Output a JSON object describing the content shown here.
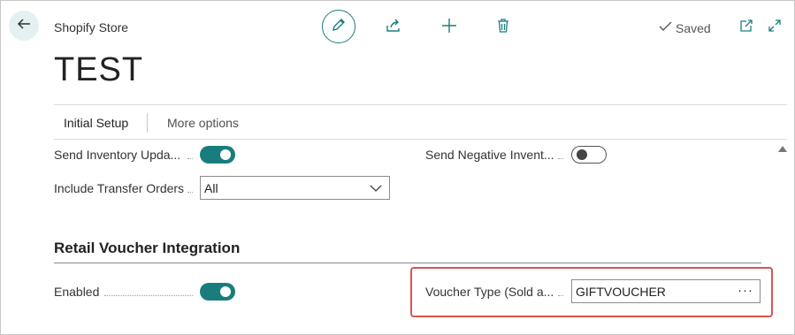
{
  "header": {
    "caption": "Shopify Store",
    "title": "TEST",
    "status": "Saved"
  },
  "tabs": [
    {
      "label": "Initial Setup"
    },
    {
      "label": "More options"
    }
  ],
  "fields": {
    "send_inventory_update": {
      "label": "Send Inventory Upda...",
      "value": true
    },
    "send_negative_inventory": {
      "label": "Send Negative Invent...",
      "value": false
    },
    "include_transfer_orders": {
      "label": "Include Transfer Orders",
      "value": "All"
    }
  },
  "section": {
    "title": "Retail Voucher Integration",
    "enabled": {
      "label": "Enabled",
      "value": true
    },
    "voucher_type": {
      "label": "Voucher Type (Sold a...",
      "value": "GIFTVOUCHER",
      "lookup": "···"
    }
  },
  "icons": {
    "back": "arrow-left-icon",
    "edit": "pencil-icon",
    "share": "share-icon",
    "add": "plus-icon",
    "delete": "trash-icon",
    "saved": "checkmark-icon",
    "open_new": "open-in-new-icon",
    "expand": "expand-icon"
  },
  "colors": {
    "accent": "#1a7d7d",
    "highlight": "#d9534f"
  }
}
